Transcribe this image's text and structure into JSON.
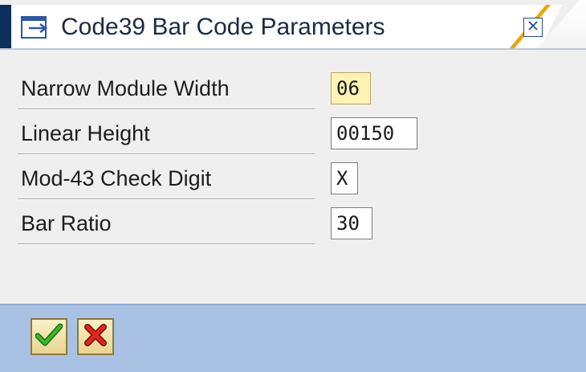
{
  "dialog": {
    "title": "Code39 Bar Code Parameters",
    "close_icon": "close-icon",
    "title_icon": "dialog-window-icon"
  },
  "fields": [
    {
      "label": "Narrow Module Width",
      "value": "06",
      "required": true
    },
    {
      "label": "Linear Height",
      "value": "00150",
      "required": false
    },
    {
      "label": "Mod-43 Check Digit",
      "value": "X",
      "required": false
    },
    {
      "label": "Bar Ratio",
      "value": "30",
      "required": false
    }
  ],
  "footer": {
    "confirm_icon": "checkmark-icon",
    "cancel_icon": "cancel-x-icon"
  },
  "colors": {
    "title_bar_dark": "#0c2f5c",
    "title_accent": "#f0a400",
    "footer_bg": "#a9c1e3",
    "required_field_bg": "#fff3b4",
    "confirm_green": "#2e9e1f",
    "cancel_red": "#d0201a"
  }
}
